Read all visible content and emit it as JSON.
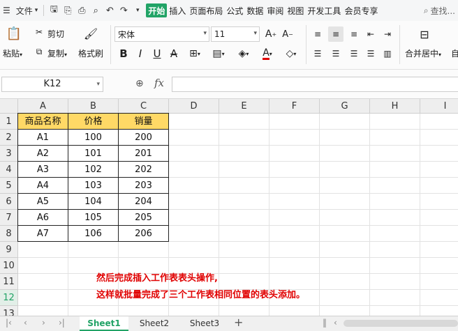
{
  "menubar": {
    "file_label": "文件",
    "tabs": [
      {
        "label": "开始",
        "active": true
      },
      {
        "label": "插入",
        "active": false
      },
      {
        "label": "页面布局",
        "active": false
      },
      {
        "label": "公式",
        "active": false
      },
      {
        "label": "数据",
        "active": false
      },
      {
        "label": "审阅",
        "active": false
      },
      {
        "label": "视图",
        "active": false
      },
      {
        "label": "开发工具",
        "active": false
      },
      {
        "label": "会员专享",
        "active": false
      }
    ],
    "search_label": "查找..."
  },
  "ribbon": {
    "paste_label": "粘贴",
    "cut_label": "剪切",
    "copy_label": "复制",
    "format_painter_label": "格式刷",
    "font_name": "宋体",
    "font_size": "11",
    "merge_label": "合并居中",
    "auto_wrap_label": "自"
  },
  "formulabar": {
    "cell_ref": "K12",
    "fx_label": "fx",
    "formula": ""
  },
  "grid": {
    "columns": [
      "A",
      "B",
      "C",
      "D",
      "E",
      "F",
      "G",
      "H",
      "I"
    ],
    "rows": [
      "1",
      "2",
      "3",
      "4",
      "5",
      "6",
      "7",
      "8",
      "9",
      "10",
      "11",
      "12",
      "13"
    ],
    "selected_row": "12",
    "table": {
      "headers": [
        "商品名称",
        "价格",
        "销量"
      ],
      "rows": [
        [
          "A1",
          "100",
          "200"
        ],
        [
          "A2",
          "101",
          "201"
        ],
        [
          "A3",
          "102",
          "202"
        ],
        [
          "A4",
          "103",
          "203"
        ],
        [
          "A5",
          "104",
          "204"
        ],
        [
          "A6",
          "105",
          "205"
        ],
        [
          "A7",
          "106",
          "206"
        ]
      ]
    },
    "note_line1": "然后完成插入工作表表头操作,",
    "note_line2": "这样就批量完成了三个工作表相同位置的表头添加。"
  },
  "sheets": [
    {
      "label": "Sheet1",
      "active": true
    },
    {
      "label": "Sheet2",
      "active": false
    },
    {
      "label": "Sheet3",
      "active": false
    }
  ],
  "colors": {
    "accent": "#21a366",
    "header_fill": "#ffd966",
    "note": "#e00000"
  }
}
